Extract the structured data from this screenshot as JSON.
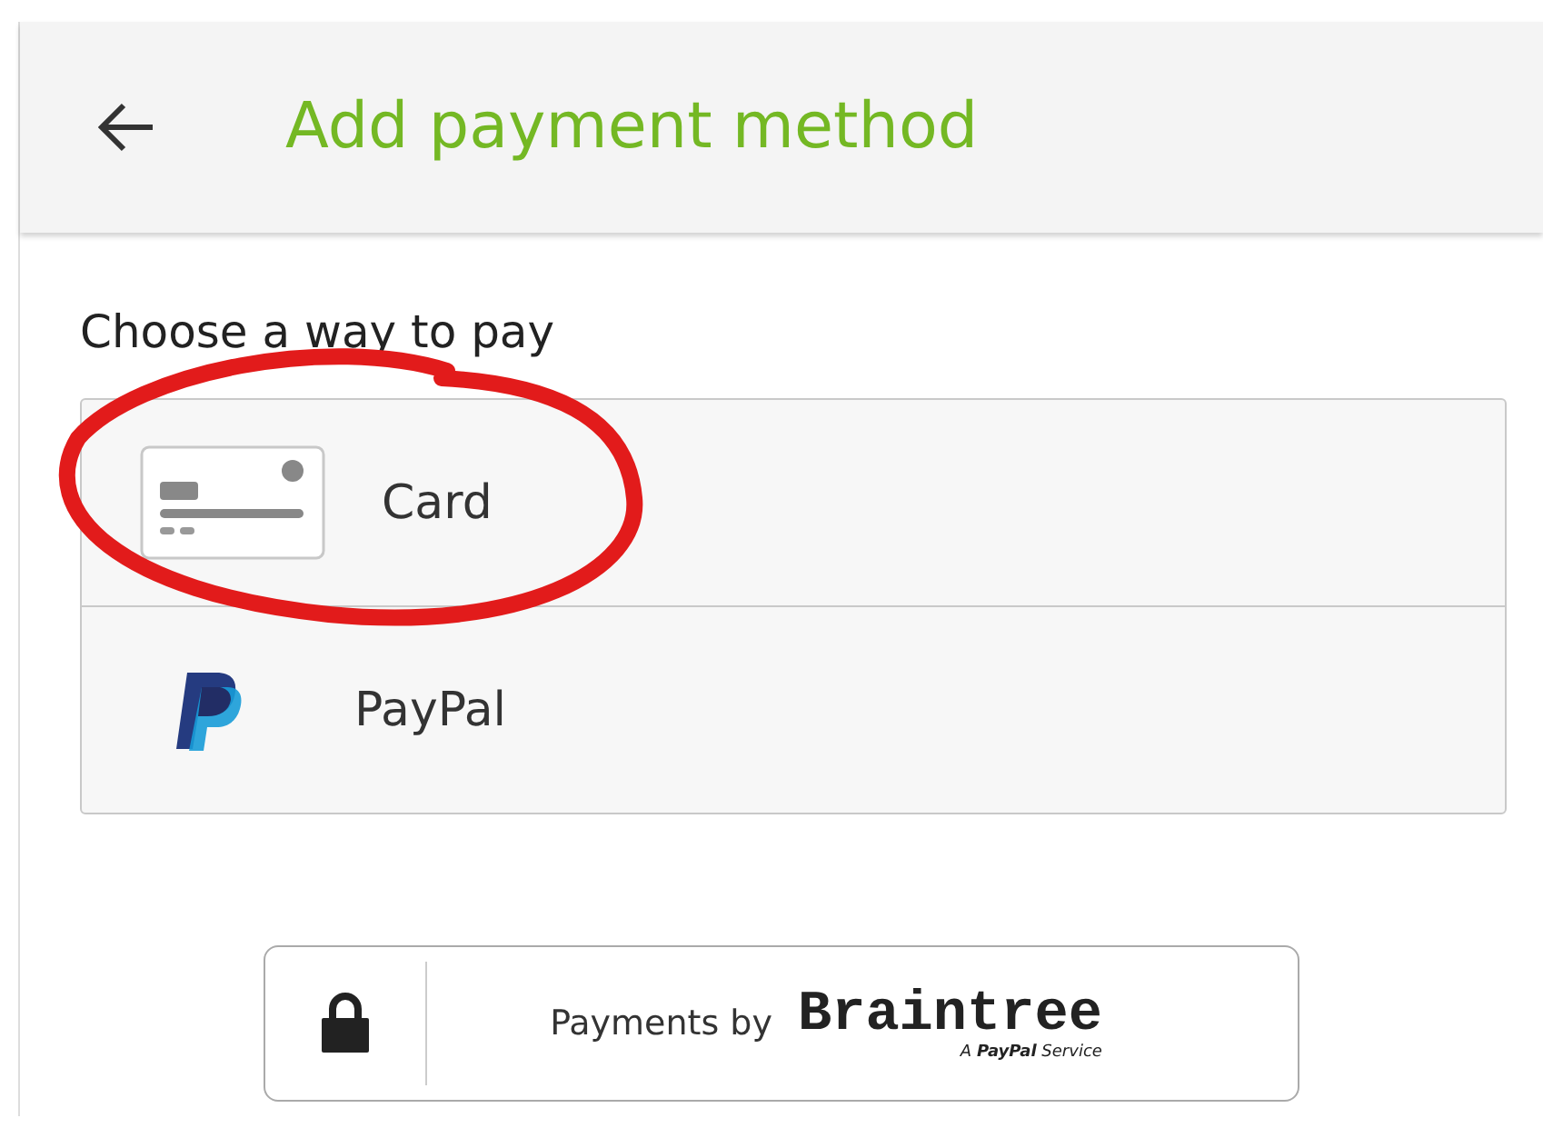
{
  "header": {
    "title": "Add payment method"
  },
  "prompt": "Choose a way to pay",
  "methods": [
    {
      "kind": "card",
      "label": "Card",
      "circled": true
    },
    {
      "kind": "paypal",
      "label": "PayPal",
      "circled": false
    }
  ],
  "badge": {
    "lead": "Payments by",
    "brand": "Braintree",
    "tagline": "A **PayPal** Service"
  }
}
